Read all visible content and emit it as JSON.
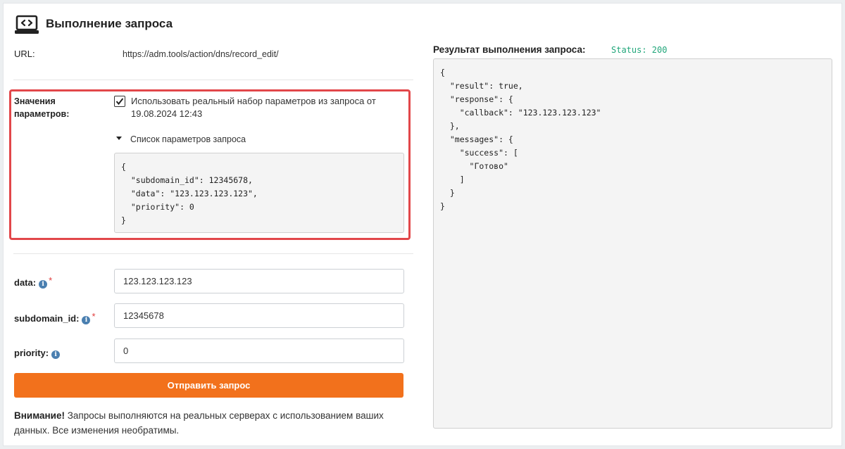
{
  "header": {
    "title": "Выполнение запроса",
    "icon": "laptop-code-icon"
  },
  "url": {
    "label": "URL:",
    "value": "https://adm.tools/action/dns/record_edit/"
  },
  "params": {
    "label_line1": "Значения",
    "label_line2": "параметров:",
    "checkbox_checked": true,
    "checkbox_line1": "Использовать реальный набор параметров из запроса от",
    "checkbox_line2": "19.08.2024 12:43",
    "list_toggle": "Список параметров запроса",
    "json": "{\n  \"subdomain_id\": 12345678,\n  \"data\": \"123.123.123.123\",\n  \"priority\": 0\n}"
  },
  "fields": [
    {
      "label": "data:",
      "required": "*",
      "value": "123.123.123.123"
    },
    {
      "label": "subdomain_id:",
      "required": "*",
      "value": "12345678"
    },
    {
      "label": "priority:",
      "required": "",
      "value": "0"
    }
  ],
  "submit_label": "Отправить запрос",
  "warning": {
    "bold": "Внимание!",
    "text": " Запросы выполняются на реальных серверах с использованием ваших данных. Все изменения необратимы."
  },
  "result": {
    "label": "Результат выполнения запроса:",
    "status": "Status: 200",
    "json": "{\n  \"result\": true,\n  \"response\": {\n    \"callback\": \"123.123.123.123\"\n  },\n  \"messages\": {\n    \"success\": [\n      \"Готово\"\n    ]\n  }\n}"
  },
  "colors": {
    "accent": "#f2711c",
    "status": "#21a67a",
    "highlight": "#e2474a",
    "info": "#4a7fb0"
  }
}
